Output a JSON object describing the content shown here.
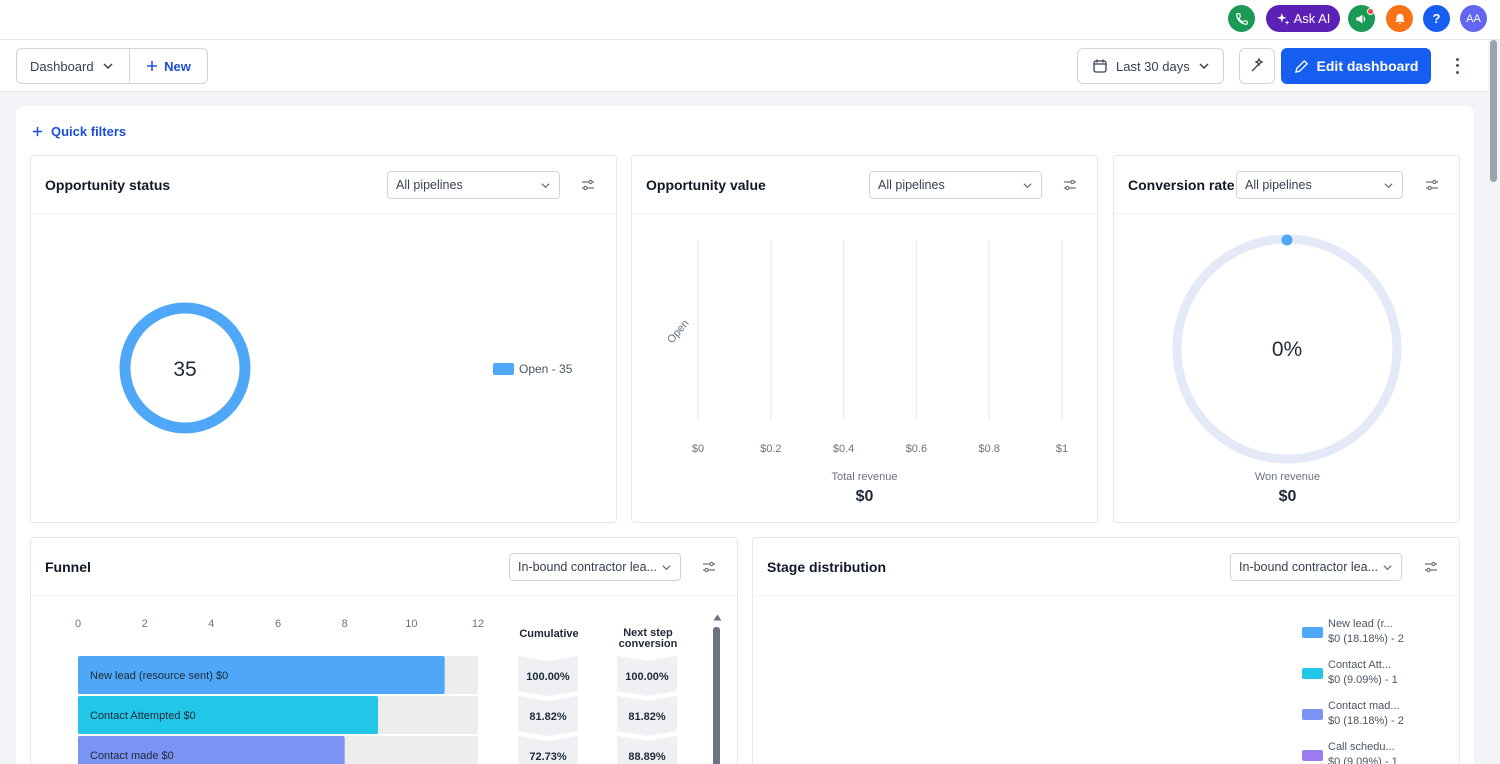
{
  "header": {
    "ask_ai_label": "Ask AI",
    "avatar_initials": "AA",
    "help_label": "?",
    "icons": [
      "phone-icon",
      "sparkle-icon",
      "megaphone-icon",
      "bell-icon",
      "help-icon"
    ],
    "colors": {
      "phone": "#1a9a55",
      "ask_ai": "#5b21b6",
      "megaphone": "#1a9a55",
      "bell": "#f97316",
      "help": "#155eef",
      "avatar": "#6366f1"
    }
  },
  "toolbar": {
    "dashboard_label": "Dashboard",
    "new_label": "New",
    "date_range_label": "Last 30 days",
    "edit_label": "Edit dashboard"
  },
  "quick_filters_label": "Quick filters",
  "opportunity_status": {
    "title": "Opportunity status",
    "pipeline": "All pipelines",
    "total": "35",
    "legend": "Open - 35",
    "color": "#4ea8f7"
  },
  "opportunity_value": {
    "title": "Opportunity value",
    "pipeline": "All pipelines",
    "y_category": "Open",
    "x_ticks": [
      "$0",
      "$0.2",
      "$0.4",
      "$0.6",
      "$0.8",
      "$1"
    ],
    "total_label": "Total revenue",
    "total_value": "$0"
  },
  "conversion_rate": {
    "title": "Conversion rate",
    "pipeline": "All pipelines",
    "value": "0%",
    "won_label": "Won revenue",
    "won_value": "$0"
  },
  "funnel": {
    "title": "Funnel",
    "pipeline": "In-bound contractor lea...",
    "x_ticks": [
      "0",
      "2",
      "4",
      "6",
      "8",
      "10",
      "12"
    ],
    "col_cumulative": "Cumulative",
    "col_next": "Next step conversion",
    "rows": [
      {
        "label": "New lead (resource sent)   $0",
        "cumulative": "100.00%",
        "next": "100.00%",
        "color": "#4ea8f7"
      },
      {
        "label": "Contact Attempted   $0",
        "cumulative": "81.82%",
        "next": "81.82%",
        "color": "#22c7e8"
      },
      {
        "label": "Contact made   $0",
        "cumulative": "72.73%",
        "next": "88.89%",
        "color": "#7b93f2"
      }
    ]
  },
  "stage_distribution": {
    "title": "Stage distribution",
    "pipeline": "In-bound contractor lea...",
    "legend": [
      {
        "name": "New lead (r...",
        "detail": "$0 (18.18%) - 2",
        "color": "#4ea8f7"
      },
      {
        "name": "Contact Att...",
        "detail": "$0 (9.09%) - 1",
        "color": "#22c7e8"
      },
      {
        "name": "Contact mad...",
        "detail": "$0 (18.18%) - 2",
        "color": "#7b93f2"
      },
      {
        "name": "Call schedu...",
        "detail": "$0 (9.09%) - 1",
        "color": "#9b7cf0"
      }
    ]
  },
  "chart_data": [
    {
      "type": "pie",
      "title": "Opportunity status",
      "categories": [
        "Open"
      ],
      "values": [
        35
      ]
    },
    {
      "type": "bar",
      "title": "Opportunity value",
      "categories": [
        "Open"
      ],
      "values": [
        0
      ],
      "xlim": [
        0,
        1
      ]
    },
    {
      "type": "bar",
      "title": "Funnel",
      "categories": [
        "New lead (resource sent)",
        "Contact Attempted",
        "Contact made"
      ],
      "values": [
        11,
        9,
        8
      ],
      "xlim": [
        0,
        12
      ]
    }
  ]
}
